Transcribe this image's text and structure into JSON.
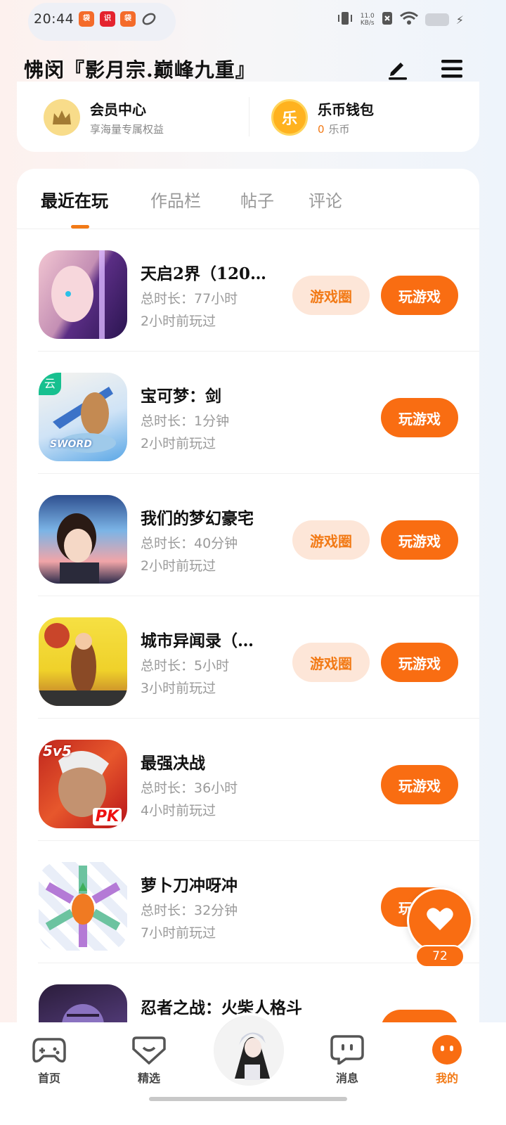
{
  "status_bar": {
    "time": "20:44",
    "net_speed": "11.0",
    "net_unit": "KB/s",
    "app_badges": [
      "袋",
      "识",
      "袋"
    ]
  },
  "header": {
    "username": "怫闵『影月宗.巅峰九重』",
    "edit_icon": "pen-icon",
    "menu_icon": "hamburger-icon"
  },
  "top_card": {
    "vip": {
      "title": "会员中心",
      "subtitle": "享海量专属权益",
      "icon": "crown-icon"
    },
    "wallet": {
      "title": "乐币钱包",
      "balance": "0",
      "unit": "乐币",
      "icon_text": "乐"
    }
  },
  "tabs": [
    {
      "label": "最近在玩",
      "active": true
    },
    {
      "label": "作品栏",
      "active": false
    },
    {
      "label": "帖子",
      "active": false
    },
    {
      "label": "评论",
      "active": false
    }
  ],
  "games": [
    {
      "name": "天启2界（120…",
      "duration": "总时长：77小时",
      "last_played": "2小时前玩过",
      "has_circle": true
    },
    {
      "name": "宝可梦：剑",
      "duration": "总时长：1分钟",
      "last_played": "2小时前玩过",
      "has_circle": false,
      "cloud_tag": "云",
      "icon_caption": "SWORD"
    },
    {
      "name": "我们的梦幻豪宅",
      "duration": "总时长：40分钟",
      "last_played": "2小时前玩过",
      "has_circle": true
    },
    {
      "name": "城市异闻录（…",
      "duration": "总时长：5小时",
      "last_played": "3小时前玩过",
      "has_circle": true
    },
    {
      "name": "最强决战",
      "duration": "总时长：36小时",
      "last_played": "4小时前玩过",
      "has_circle": false,
      "icon_badge_top": "5v5",
      "icon_badge_bottom": "PK"
    },
    {
      "name": "萝卜刀冲呀冲",
      "duration": "总时长：32分钟",
      "last_played": "7小时前玩过",
      "has_circle": false
    },
    {
      "name": "忍者之战：火柴人格斗",
      "duration": "",
      "last_played": "",
      "has_circle": false
    }
  ],
  "buttons": {
    "circle_label": "游戏圈",
    "play_label": "玩游戏"
  },
  "like": {
    "count": "72"
  },
  "bottom_nav": [
    {
      "label": "首页",
      "icon": "gamepad-icon",
      "active": false
    },
    {
      "label": "精选",
      "icon": "heart-badge-icon",
      "active": false
    },
    {
      "label": "消息",
      "icon": "chat-icon",
      "active": false
    },
    {
      "label": "我的",
      "icon": "smile-icon",
      "active": true
    }
  ],
  "colors": {
    "accent": "#f96d12",
    "accent_light": "#fde6d8",
    "cloud_green": "#17c08f"
  }
}
